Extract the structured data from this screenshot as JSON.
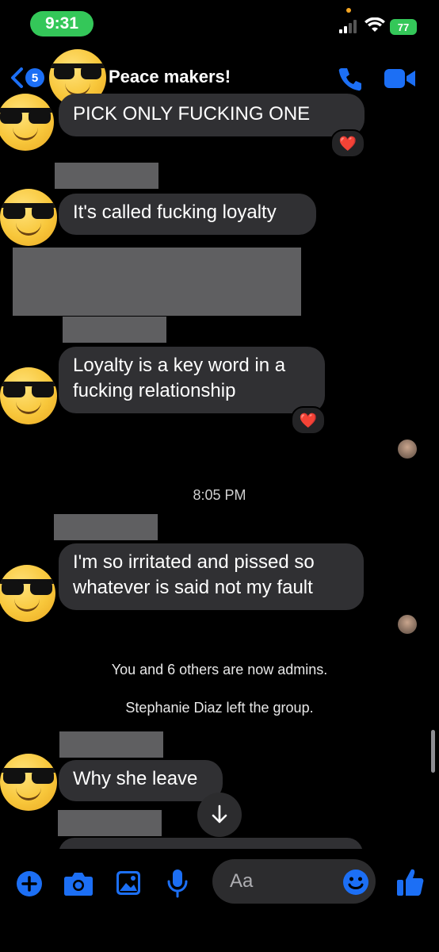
{
  "status_bar": {
    "time": "9:31",
    "battery": "77"
  },
  "header": {
    "unread_count": "5",
    "title": "Peace makers!"
  },
  "messages": {
    "m1": "PICK ONLY FUCKING ONE",
    "m2": "It's called fucking loyalty",
    "m3_line1": "Loyalty is a key word in a",
    "m3_line2": "fucking relationship",
    "timestamp": "8:05 PM",
    "m4_line1": "I'm so irritated and pissed so",
    "m4_line2": "whatever is said not my fault",
    "system1": "You and 6 others are now admins.",
    "system2": "Stephanie Diaz left the group.",
    "m5": "Why she leave"
  },
  "reactions": {
    "heart": "❤️"
  },
  "composer": {
    "placeholder": "Aa"
  },
  "icons": {
    "face": "smiling-face-with-sunglasses",
    "send_like": "thumbs-up"
  },
  "colors": {
    "accent": "#1c6ff5",
    "bubble": "#303033",
    "status_green": "#34c759"
  }
}
